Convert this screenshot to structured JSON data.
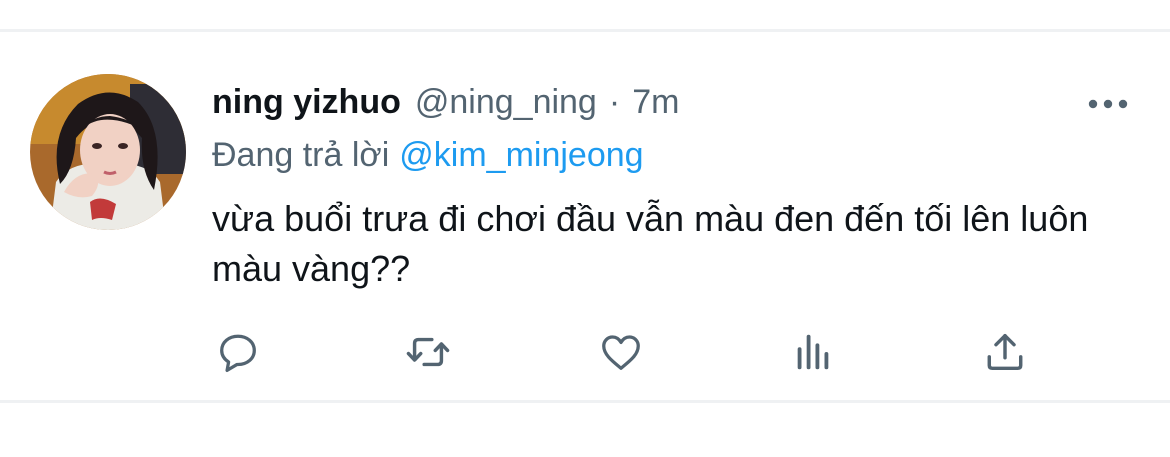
{
  "tweet": {
    "author": {
      "display_name": "ning yizhuo",
      "handle": "@ning_ning"
    },
    "separator": "·",
    "timestamp": "7m",
    "reply_to": {
      "prefix": "Đang trả lời",
      "mention": "@kim_minjeong"
    },
    "text": "vừa buổi trưa đi chơi đầu vẫn màu đen đến tối lên luôn màu vàng??"
  },
  "actions": [
    {
      "icon": "reply-icon"
    },
    {
      "icon": "retweet-icon"
    },
    {
      "icon": "like-icon"
    },
    {
      "icon": "views-icon"
    },
    {
      "icon": "share-icon"
    }
  ],
  "colors": {
    "text": "#0f1419",
    "secondary": "#536471",
    "accent": "#1d9bf0",
    "divider": "#eff1f3"
  }
}
